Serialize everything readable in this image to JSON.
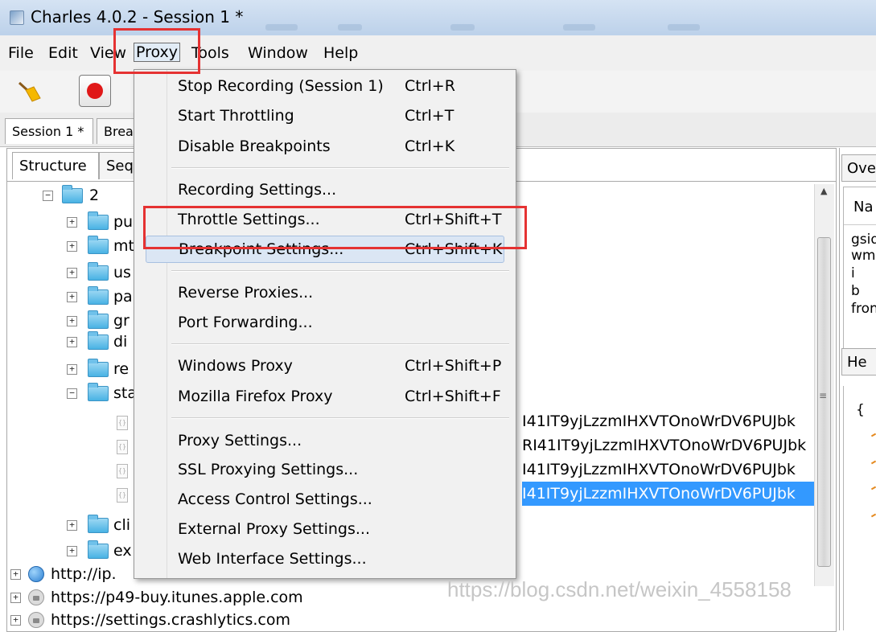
{
  "window": {
    "title": "Charles 4.0.2 - Session 1 *"
  },
  "menubar": [
    {
      "label": "File"
    },
    {
      "label": "Edit"
    },
    {
      "label": "View"
    },
    {
      "label": "Proxy"
    },
    {
      "label": "Tools"
    },
    {
      "label": "Window"
    },
    {
      "label": "Help"
    }
  ],
  "session_tabs": {
    "active": "Session 1 *",
    "other": "Brea"
  },
  "panel_tabs": {
    "structure": "Structure",
    "sequence": "Seq"
  },
  "proxy_menu": {
    "items": [
      {
        "label": "Stop Recording (Session 1)",
        "shortcut": "Ctrl+R"
      },
      {
        "label": "Start Throttling",
        "shortcut": "Ctrl+T"
      },
      {
        "label": "Disable Breakpoints",
        "shortcut": "Ctrl+K"
      },
      {
        "label": "Recording Settings...",
        "shortcut": ""
      },
      {
        "label": "Throttle Settings...",
        "shortcut": "Ctrl+Shift+T"
      },
      {
        "label": "Breakpoint Settings...",
        "shortcut": "Ctrl+Shift+K"
      },
      {
        "label": "Reverse Proxies...",
        "shortcut": ""
      },
      {
        "label": "Port Forwarding...",
        "shortcut": ""
      },
      {
        "label": "Windows Proxy",
        "shortcut": "Ctrl+Shift+P"
      },
      {
        "label": "Mozilla Firefox Proxy",
        "shortcut": "Ctrl+Shift+F"
      },
      {
        "label": "Proxy Settings...",
        "shortcut": ""
      },
      {
        "label": "SSL Proxying Settings...",
        "shortcut": ""
      },
      {
        "label": "Access Control Settings...",
        "shortcut": ""
      },
      {
        "label": "External Proxy Settings...",
        "shortcut": ""
      },
      {
        "label": "Web Interface Settings...",
        "shortcut": ""
      }
    ]
  },
  "tree": {
    "root": "2",
    "folders": [
      "pu",
      "mt",
      "us",
      "pa",
      "gr",
      "di",
      "re",
      "sta",
      "cli",
      "ex"
    ],
    "hosts": [
      "http://ip.",
      "https://p49-buy.itunes.apple.com",
      "https://settings.crashlytics.com"
    ],
    "request_rows": [
      "I41IT9yjLzzmIHXVTOnoWrDV6PUJbk",
      "RI41IT9yjLzzmIHXVTOnoWrDV6PUJbk",
      "I41IT9yjLzzmIHXVTOnoWrDV6PUJbk",
      "I41IT9yjLzzmIHXVTOnoWrDV6PUJbk"
    ]
  },
  "right_panel": {
    "tab_overview": "Ove",
    "name_header": "Na",
    "names": [
      "gsid",
      "wm",
      "i",
      "b",
      "fron"
    ],
    "tab_headers": "He",
    "brace": "{"
  },
  "watermark": "https://blog.csdn.net/weixin_4558158"
}
